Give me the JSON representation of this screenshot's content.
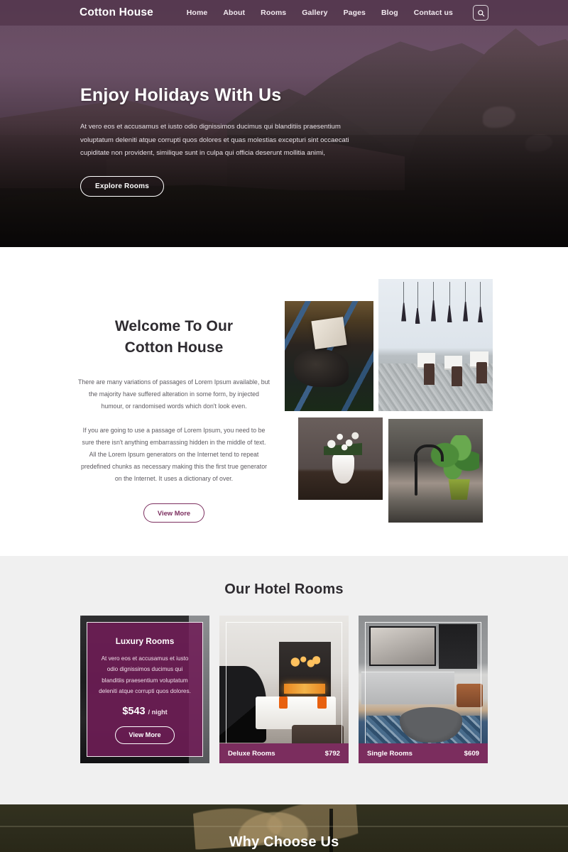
{
  "site": {
    "brand": "Cotton House"
  },
  "header": {
    "nav": [
      {
        "label": "Home"
      },
      {
        "label": "About"
      },
      {
        "label": "Rooms"
      },
      {
        "label": "Gallery"
      },
      {
        "label": "Pages"
      },
      {
        "label": "Blog"
      },
      {
        "label": "Contact us"
      }
    ],
    "search_icon": "search-icon"
  },
  "hero": {
    "title": "Enjoy Holidays With Us",
    "text": "At vero eos et accusamus et iusto odio dignissimos ducimus qui blanditiis praesentium voluptatum deleniti atque corrupti quos dolores et quas molestias excepturi sint occaecati cupiditate non provident, similique sunt in culpa qui officia deserunt mollitia animi,",
    "cta": "Explore Rooms"
  },
  "welcome": {
    "title_line1": "Welcome To Our",
    "title_line2": "Cotton House",
    "paragraph1": "There are many variations of passages of Lorem Ipsum available, but the majority have suffered alteration in some form, by injected humour, or randomised words which don't look even.",
    "paragraph2": "If you are going to use a passage of Lorem Ipsum, you need to be sure there isn't anything embarrassing hidden in the middle of text. All the Lorem Ipsum generators on the Internet tend to repeat predefined chunks as necessary making this the first true generator on the Internet. It uses a dictionary of over.",
    "cta": "View More",
    "gallery": [
      {
        "name": "bench-reading-photo"
      },
      {
        "name": "restaurant-interior-photo"
      },
      {
        "name": "white-tulips-vase-photo"
      },
      {
        "name": "kitchen-sink-plant-photo"
      }
    ]
  },
  "rooms": {
    "title": "Our Hotel Rooms",
    "cards": [
      {
        "name": "Luxury Rooms",
        "description": "At vero eos et accusamus et iusto odio dignissimos ducimus qui blanditiis praesentium voluptatum deleniti atque corrupti quos dolores.",
        "price": "$543",
        "per": "/ night",
        "cta": "View More",
        "featured": true
      },
      {
        "name": "Deluxe Rooms",
        "price": "$792",
        "featured": false
      },
      {
        "name": "Single Rooms",
        "price": "$609",
        "featured": false
      }
    ]
  },
  "why": {
    "title": "Why Choose Us"
  },
  "colors": {
    "brand_purple": "#7b2d5e",
    "header_overlay": "#55384f",
    "section_gray": "#f0f0f0",
    "dark_olive": "#2e2d1d"
  }
}
